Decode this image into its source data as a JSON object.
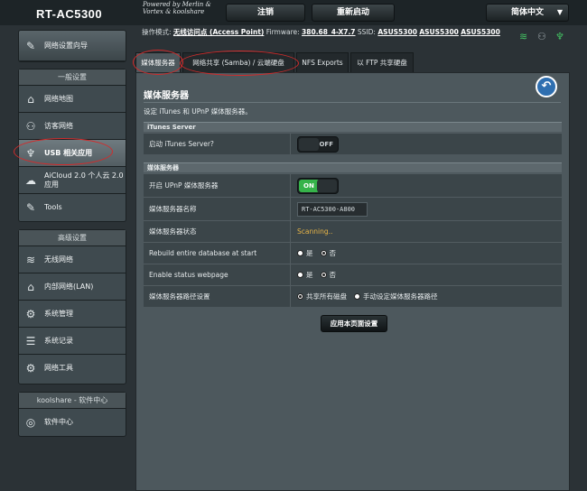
{
  "header": {
    "model": "RT-AC5300",
    "tagline": "Powered by Merlin & Vortex & koolshare",
    "logout_label": "注销",
    "reboot_label": "重新启动",
    "language": "简体中文"
  },
  "info": {
    "mode_label": "操作模式:",
    "mode_value": "无线访问点 (Access Point)",
    "firmware_label": "Firmware:",
    "firmware_value": "380.68_4-X7.7",
    "ssid_label": "SSID:",
    "ssid_values": [
      "ASUS5300",
      "ASUS5300",
      "ASUS5300"
    ]
  },
  "sidebar": {
    "qis_label": "网络设置向导",
    "general_title": "一般设置",
    "general_items": [
      {
        "label": "网络地图",
        "icon": "network-map-icon",
        "glyph": "⌂"
      },
      {
        "label": "访客网络",
        "icon": "guest-network-icon",
        "glyph": "⚇"
      },
      {
        "label": "USB 相关应用",
        "icon": "usb-icon",
        "glyph": "♆"
      },
      {
        "label": "AiCloud 2.0 个人云 2.0 应用",
        "icon": "cloud-icon",
        "glyph": "☁"
      },
      {
        "label": "Tools",
        "icon": "wrench-icon",
        "glyph": "✎"
      }
    ],
    "advanced_title": "高级设置",
    "advanced_items": [
      {
        "label": "无线网络",
        "icon": "wireless-icon",
        "glyph": "≋"
      },
      {
        "label": "内部网络(LAN)",
        "icon": "lan-icon",
        "glyph": "⌂"
      },
      {
        "label": "系统管理",
        "icon": "admin-icon",
        "glyph": "⚙"
      },
      {
        "label": "系统记录",
        "icon": "log-icon",
        "glyph": "☰"
      },
      {
        "label": "网络工具",
        "icon": "tools-icon",
        "glyph": "⚙"
      }
    ],
    "koolshare_title": "koolshare - 软件中心",
    "koolshare_item": {
      "label": "软件中心",
      "icon": "software-center-icon",
      "glyph": "◎"
    }
  },
  "tabs": [
    "媒体服务器",
    "网络共享 (Samba) / 云端硬盘",
    "NFS Exports",
    "以 FTP 共享硬盘"
  ],
  "page": {
    "title": "媒体服务器",
    "description": "设定 iTunes 和 UPnP 媒体服务器。",
    "itunes_section": "iTunes Server",
    "itunes_label": "启动 iTunes Server?",
    "itunes_toggle": "OFF",
    "media_section": "媒体服务器",
    "upnp_label": "开启 UPnP 媒体服务器",
    "upnp_toggle": "ON",
    "name_label": "媒体服务器名称",
    "name_value": "RT-AC5300-A800",
    "status_label": "媒体服务器状态",
    "status_value": "Scanning..",
    "rebuild_label": "Rebuild entire database at start",
    "status_page_label": "Enable status webpage",
    "yes": "是",
    "no": "否",
    "path_label": "媒体服务器路径设置",
    "path_opt1": "共享所有磁盘",
    "path_opt2": "手动设定媒体服务器路径",
    "apply_label": "应用本页面设置"
  },
  "colors": {
    "accent_on": "#36b34a",
    "status": "#e8b547",
    "annotation": "#d22b2b"
  }
}
